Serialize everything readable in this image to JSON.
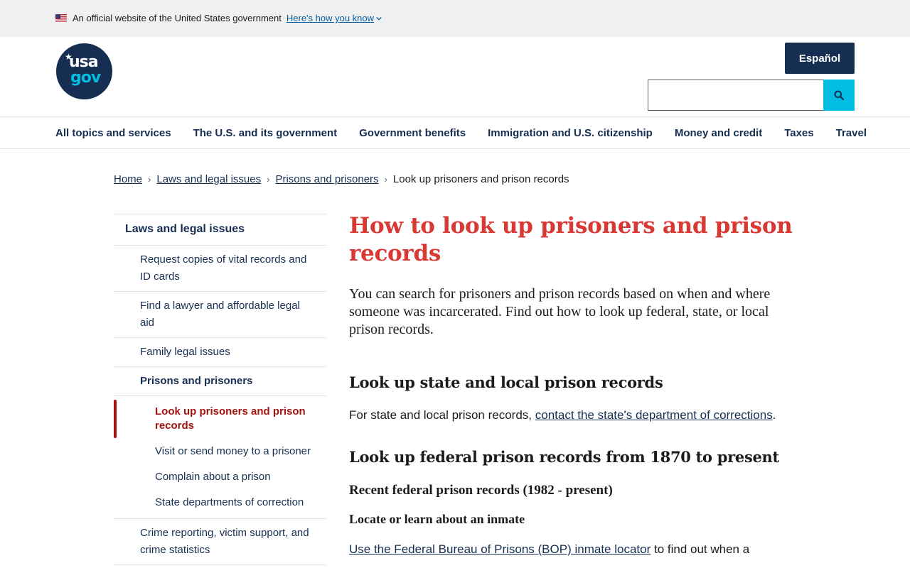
{
  "banner": {
    "official_text": "An official website of the United States government",
    "how_you_know": "Here's how you know"
  },
  "header": {
    "logo_top": "usa",
    "logo_bottom": "gov",
    "espanol_label": "Español",
    "search_placeholder": ""
  },
  "nav": {
    "items": [
      "All topics and services",
      "The U.S. and its government",
      "Government benefits",
      "Immigration and U.S. citizenship",
      "Money and credit",
      "Taxes",
      "Travel"
    ]
  },
  "breadcrumb": {
    "items": [
      "Home",
      "Laws and legal issues",
      "Prisons and prisoners"
    ],
    "current": "Look up prisoners and prison records"
  },
  "sidenav": {
    "top": "Laws and legal issues",
    "level1": [
      "Request copies of vital records and ID cards",
      "Find a lawyer and affordable legal aid",
      "Family legal issues",
      "Prisons and prisoners",
      "Crime reporting, victim support, and crime statistics"
    ],
    "level2": [
      "Look up prisoners and prison records",
      "Visit or send money to a prisoner",
      "Complain about a prison",
      "State departments of correction"
    ]
  },
  "main": {
    "title": "How to look up prisoners and prison records",
    "intro": "You can search for prisoners and prison records based on when and where someone was incarcerated. Find out how to look up federal, state, or local prison records.",
    "section1_heading": "Look up state and local prison records",
    "section1_text_before": "For state and local prison records, ",
    "section1_link": "contact the state's department of corrections",
    "section1_text_after": ".",
    "section2_heading": "Look up federal prison records from 1870 to present",
    "section2_sub": "Recent federal prison records (1982 - present)",
    "section2_subsub": "Locate or learn about an inmate",
    "section2_link": "Use the Federal Bureau of Prisons (BOP) inmate locator",
    "section2_text_after": " to find out when a"
  }
}
